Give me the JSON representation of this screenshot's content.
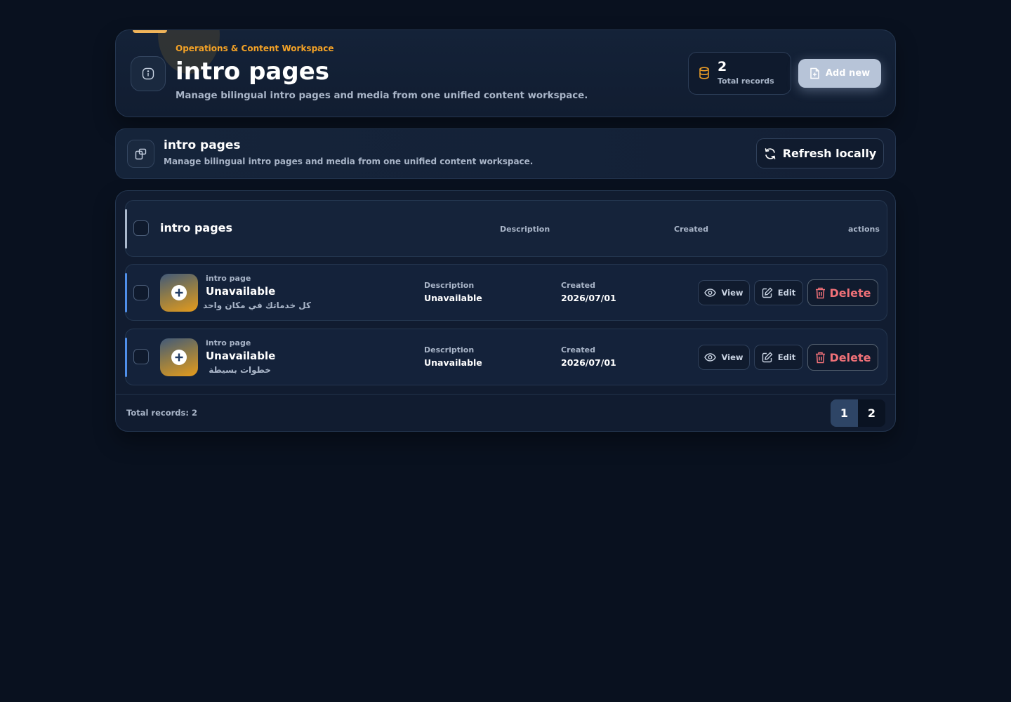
{
  "hero": {
    "eyebrow": "Operations & Content Workspace",
    "title": "intro pages",
    "subtitle": "Manage bilingual intro pages and media from one unified content workspace.",
    "stat_value": "2",
    "stat_label": "Total records",
    "add_label": "Add new",
    "accent_color": "#f4a226"
  },
  "section": {
    "title": "intro pages",
    "subtitle": "Manage bilingual intro pages and media from one unified content workspace.",
    "refresh_label": "Refresh locally"
  },
  "table": {
    "header_title": "intro pages",
    "columns": [
      "Description",
      "Created",
      "actions"
    ],
    "rows": [
      {
        "kicker": "intro page",
        "title": "Unavailable",
        "arabic": "كل خدماتك في مكان واحد",
        "desc_label": "Description",
        "desc_value": "Unavailable",
        "created_label": "Created",
        "created_value": "2026/07/01",
        "view_label": "View",
        "edit_label": "Edit",
        "delete_label": "Delete"
      },
      {
        "kicker": "intro page",
        "title": "Unavailable",
        "arabic": "خطوات بسيطة",
        "desc_label": "Description",
        "desc_value": "Unavailable",
        "created_label": "Created",
        "created_value": "2026/07/01",
        "view_label": "View",
        "edit_label": "Edit",
        "delete_label": "Delete"
      }
    ],
    "footer_total": "Total records: 2",
    "pages": [
      "1",
      "2"
    ],
    "delete_color": "#f07178",
    "row_accent_color": "#4f8fea"
  },
  "icons": {
    "hero": "info-icon",
    "stat": "database-icon",
    "add": "file-plus-icon",
    "section": "device-icon",
    "refresh": "refresh-icon",
    "thumb": "plus-circle-icon",
    "view": "eye-icon",
    "edit": "pencil-icon",
    "delete": "trash-icon"
  }
}
